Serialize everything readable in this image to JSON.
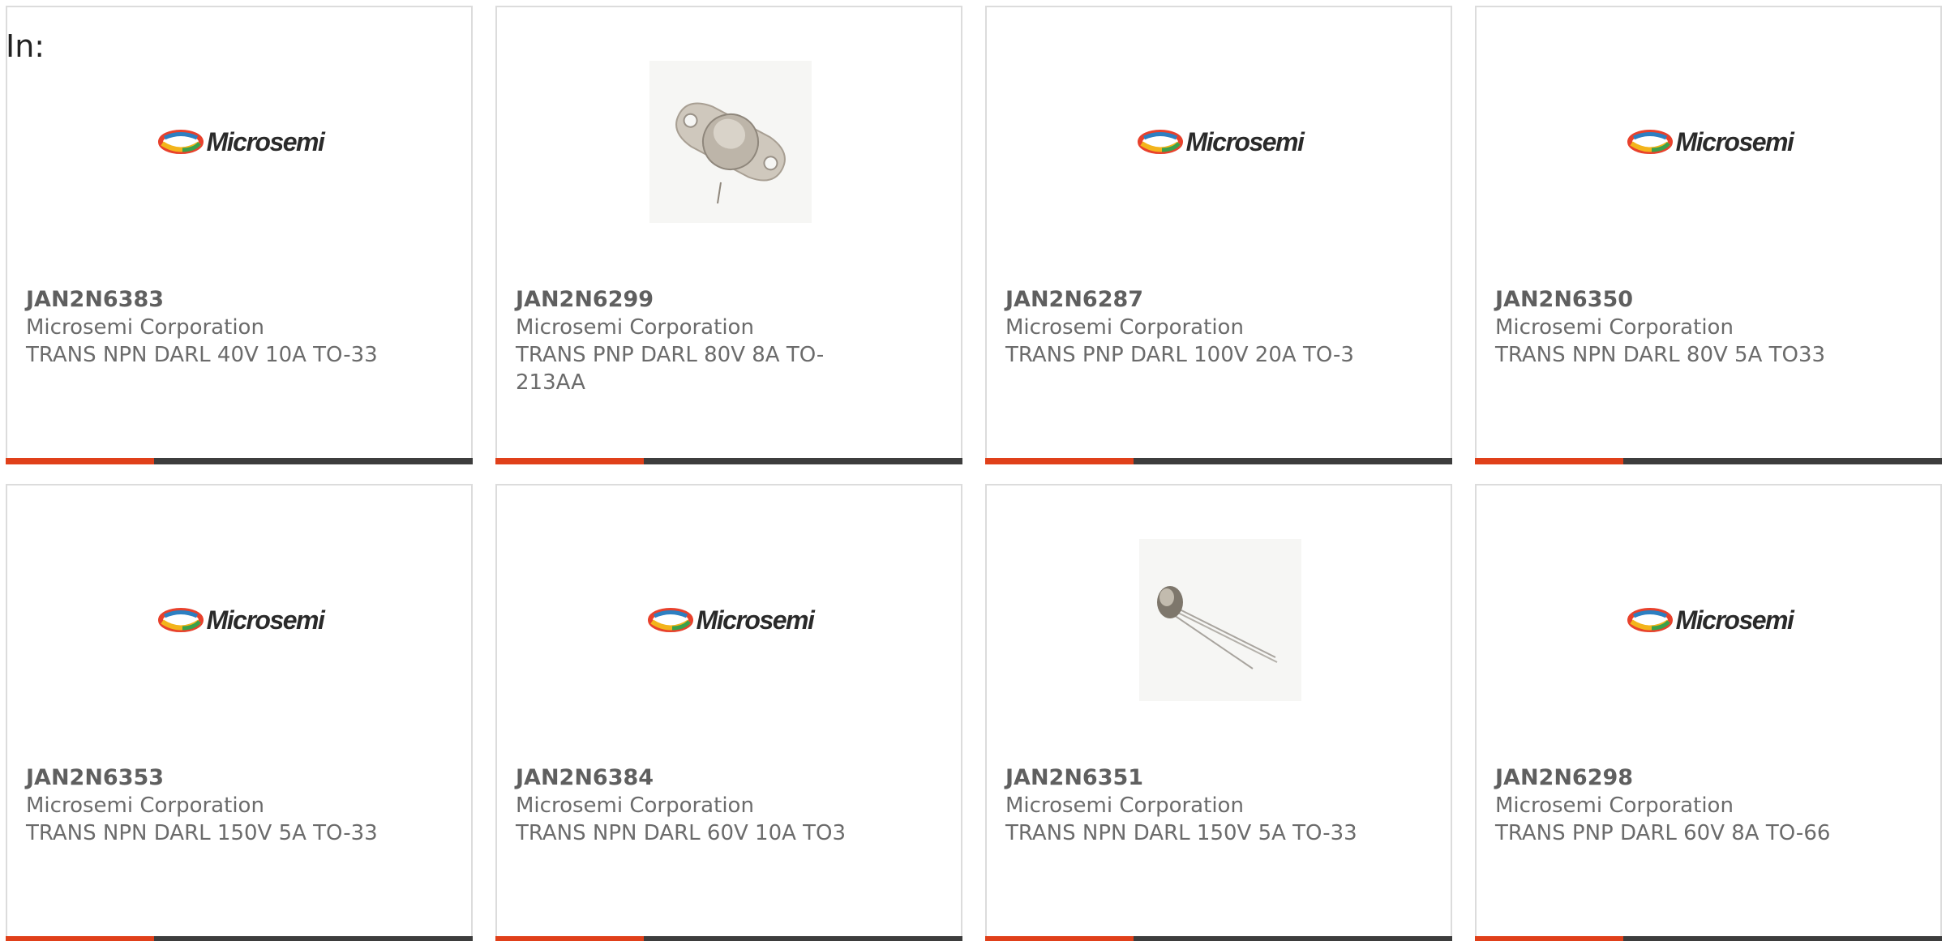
{
  "header": {
    "in_label": "In:"
  },
  "brand": {
    "logo_text": "Microsemi",
    "accent": "#e0401a",
    "bar": "#3d3d3d"
  },
  "cards": [
    {
      "part": "JAN2N6383",
      "maker": "Microsemi Corporation",
      "desc": "TRANS NPN DARL 40V 10A TO-33",
      "image": "microsemi-logo"
    },
    {
      "part": "JAN2N6299",
      "maker": "Microsemi Corporation",
      "desc": "TRANS PNP DARL 80V 8A TO-213AA",
      "image": "to-213aa-package-photo"
    },
    {
      "part": "JAN2N6287",
      "maker": "Microsemi Corporation",
      "desc": "TRANS PNP DARL 100V 20A TO-3",
      "image": "microsemi-logo"
    },
    {
      "part": "JAN2N6350",
      "maker": "Microsemi Corporation",
      "desc": "TRANS NPN DARL 80V 5A TO33",
      "image": "microsemi-logo"
    },
    {
      "part": "JAN2N6353",
      "maker": "Microsemi Corporation",
      "desc": "TRANS NPN DARL 150V 5A TO-33",
      "image": "microsemi-logo"
    },
    {
      "part": "JAN2N6384",
      "maker": "Microsemi Corporation",
      "desc": "TRANS NPN DARL 60V 10A TO3",
      "image": "microsemi-logo"
    },
    {
      "part": "JAN2N6351",
      "maker": "Microsemi Corporation",
      "desc": "TRANS NPN DARL 150V 5A TO-33",
      "image": "to-39-package-photo"
    },
    {
      "part": "JAN2N6298",
      "maker": "Microsemi Corporation",
      "desc": "TRANS PNP DARL 60V 8A TO-66",
      "image": "microsemi-logo"
    }
  ]
}
